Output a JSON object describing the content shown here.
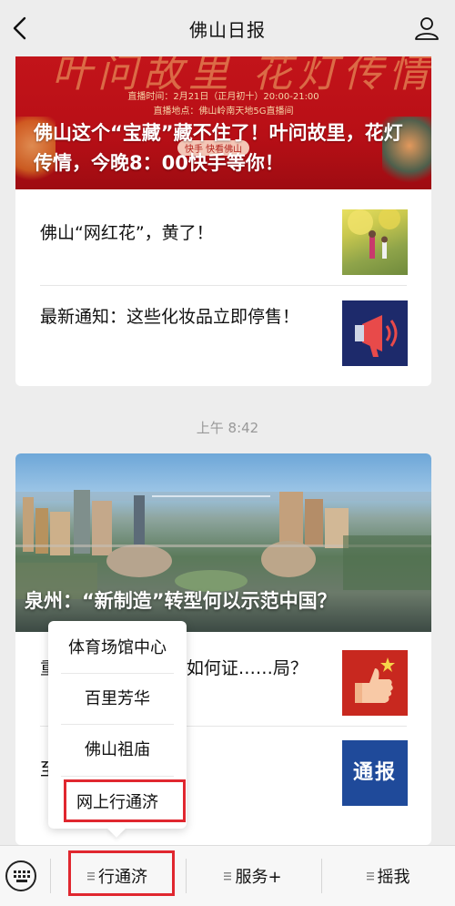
{
  "header": {
    "title": "佛山日报"
  },
  "card1": {
    "hero": {
      "deco_title": "叶问故里 花灯传情",
      "info_time": "直播时间：2月21日（正月初十）20:00-21:00",
      "info_place": "直播地点：佛山岭南天地5G直播间",
      "kuaishou": "快手 快看佛山",
      "headline": "佛山这个“宝藏”藏不住了！叶问故里，花灯传情，今晚8：00快手等你！"
    },
    "items": [
      {
        "title": "佛山“网红花”，黄了！"
      },
      {
        "title": "最新通知：这些化妆品立即停售！"
      }
    ]
  },
  "timestamp": "上午 8:42",
  "card2": {
    "hero": {
      "headline": "泉州：“新制造”转型何以示范中国？"
    },
    "items": [
      {
        "title": "重……GDP 之城，如何证……局？"
      },
      {
        "title": "至……"
      }
    ],
    "thumb2_label": "通报"
  },
  "popup": {
    "items": [
      "体育场馆中心",
      "百里芳华",
      "佛山祖庙",
      "网上行通济"
    ]
  },
  "bottombar": {
    "tabs": [
      "行通济",
      "服务+",
      "摇我"
    ]
  },
  "colors": {
    "highlight": "#e0272f",
    "background": "#ededed"
  },
  "icons": [
    "back-arrow-icon",
    "profile-icon",
    "keyboard-icon",
    "menu-lines-icon"
  ]
}
